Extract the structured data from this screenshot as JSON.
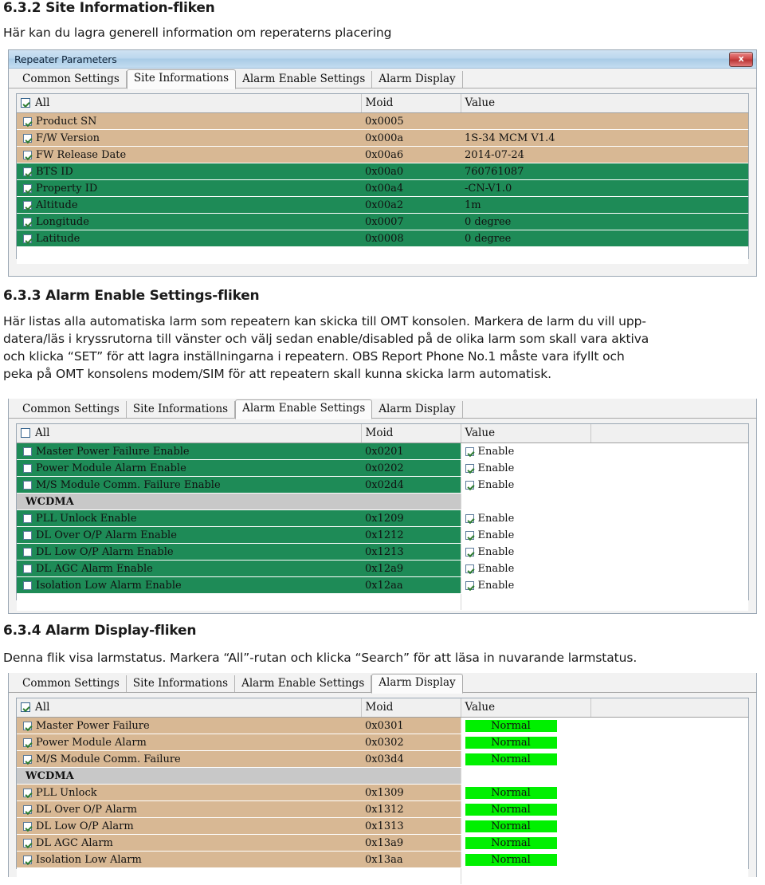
{
  "sections": [
    {
      "heading": "6.3.2 Site Information-fliken",
      "paragraph": [
        "Här kan du lagra generell information om reperaterns placering"
      ]
    },
    {
      "heading": "6.3.3 Alarm Enable Settings-fliken",
      "paragraph": [
        "Här listas alla automatiska larm som repeatern kan skicka till OMT konsolen. Markera de larm du vill upp-",
        "datera/läs i kryssrutorna till vänster och välj sedan enable/disabled på de olika larm som skall vara aktiva",
        "och klicka “SET” för att lagra inställningarna i repeatern. OBS Report Phone No.1 måste vara ifyllt och",
        "peka på OMT konsolens modem/SIM för att repeatern skall kunna skicka larm automatisk."
      ]
    },
    {
      "heading": "6.3.4 Alarm Display-fliken",
      "paragraph": [
        "Denna flik visa larmstatus. Markera “All”-rutan och klicka “Search” för att läsa in nuvarande larmstatus."
      ]
    }
  ],
  "window": {
    "title": "Repeater Parameters",
    "close_label": "x"
  },
  "tabs": [
    "Common Settings",
    "Site Informations",
    "Alarm Enable Settings",
    "Alarm Display"
  ],
  "columns": {
    "name": "All",
    "moid": "Moid",
    "value": "Value"
  },
  "colors": {
    "row_tan": "#d8b894",
    "row_green": "#1e8b57",
    "group_gray": "#c8c8c8",
    "status_green": "#00f000",
    "titlebar_blue": "#a9cbe6",
    "close_red": "#d04a4a"
  },
  "screens": [
    {
      "id": "site-informations",
      "active_tab": "Site Informations",
      "header_checked": true,
      "rows": [
        {
          "checked": true,
          "label": "Product SN",
          "moid": "0x0005",
          "value": "",
          "tint": "tan"
        },
        {
          "checked": true,
          "label": "F/W Version",
          "moid": "0x000a",
          "value": "1S-34 MCM V1.4",
          "tint": "tan"
        },
        {
          "checked": true,
          "label": "FW Release Date",
          "moid": "0x00a6",
          "value": "2014-07-24",
          "tint": "tan"
        },
        {
          "checked": true,
          "label": "BTS ID",
          "moid": "0x00a0",
          "value": "760761087",
          "tint": "green"
        },
        {
          "checked": true,
          "label": "Property ID",
          "moid": "0x00a4",
          "value": "-CN-V1.0",
          "tint": "green"
        },
        {
          "checked": true,
          "label": "Altitude",
          "moid": "0x00a2",
          "value": "1m",
          "tint": "green"
        },
        {
          "checked": true,
          "label": "Longitude",
          "moid": "0x0007",
          "value": "0 degree",
          "tint": "green"
        },
        {
          "checked": true,
          "label": "Latitude",
          "moid": "0x0008",
          "value": "0 degree",
          "tint": "green"
        }
      ]
    },
    {
      "id": "alarm-enable-settings",
      "active_tab": "Alarm Enable Settings",
      "header_checked": false,
      "rows": [
        {
          "checked": false,
          "label": "Master Power Failure Enable",
          "moid": "0x0201",
          "value": "Enable",
          "value_checked": true,
          "tint": "green"
        },
        {
          "checked": false,
          "label": "Power Module Alarm Enable",
          "moid": "0x0202",
          "value": "Enable",
          "value_checked": true,
          "tint": "green"
        },
        {
          "checked": false,
          "label": "M/S Module Comm. Failure Enable",
          "moid": "0x02d4",
          "value": "Enable",
          "value_checked": true,
          "tint": "green"
        },
        {
          "group": true,
          "label": "WCDMA",
          "moid": "",
          "value": "",
          "tint": "group"
        },
        {
          "checked": false,
          "label": "PLL Unlock Enable",
          "moid": "0x1209",
          "value": "Enable",
          "value_checked": true,
          "tint": "green"
        },
        {
          "checked": false,
          "label": "DL Over O/P Alarm Enable",
          "moid": "0x1212",
          "value": "Enable",
          "value_checked": true,
          "tint": "green"
        },
        {
          "checked": false,
          "label": "DL Low O/P Alarm Enable",
          "moid": "0x1213",
          "value": "Enable",
          "value_checked": true,
          "tint": "green"
        },
        {
          "checked": false,
          "label": "DL AGC Alarm Enable",
          "moid": "0x12a9",
          "value": "Enable",
          "value_checked": true,
          "tint": "green"
        },
        {
          "checked": false,
          "label": "Isolation Low Alarm Enable",
          "moid": "0x12aa",
          "value": "Enable",
          "value_checked": true,
          "tint": "green"
        }
      ]
    },
    {
      "id": "alarm-display",
      "active_tab": "Alarm Display",
      "header_checked": true,
      "rows": [
        {
          "checked": true,
          "label": "Master Power Failure",
          "moid": "0x0301",
          "value": "Normal",
          "chip": true,
          "tint": "tan"
        },
        {
          "checked": true,
          "label": "Power Module Alarm",
          "moid": "0x0302",
          "value": "Normal",
          "chip": true,
          "tint": "tan"
        },
        {
          "checked": true,
          "label": "M/S Module Comm. Failure",
          "moid": "0x03d4",
          "value": "Normal",
          "chip": true,
          "tint": "tan"
        },
        {
          "group": true,
          "label": "WCDMA",
          "moid": "",
          "value": "",
          "tint": "group"
        },
        {
          "checked": true,
          "label": "PLL Unlock",
          "moid": "0x1309",
          "value": "Normal",
          "chip": true,
          "tint": "tan"
        },
        {
          "checked": true,
          "label": "DL Over O/P Alarm",
          "moid": "0x1312",
          "value": "Normal",
          "chip": true,
          "tint": "tan"
        },
        {
          "checked": true,
          "label": "DL Low O/P Alarm",
          "moid": "0x1313",
          "value": "Normal",
          "chip": true,
          "tint": "tan"
        },
        {
          "checked": true,
          "label": "DL AGC Alarm",
          "moid": "0x13a9",
          "value": "Normal",
          "chip": true,
          "tint": "tan"
        },
        {
          "checked": true,
          "label": "Isolation Low Alarm",
          "moid": "0x13aa",
          "value": "Normal",
          "chip": true,
          "tint": "tan"
        }
      ]
    }
  ]
}
